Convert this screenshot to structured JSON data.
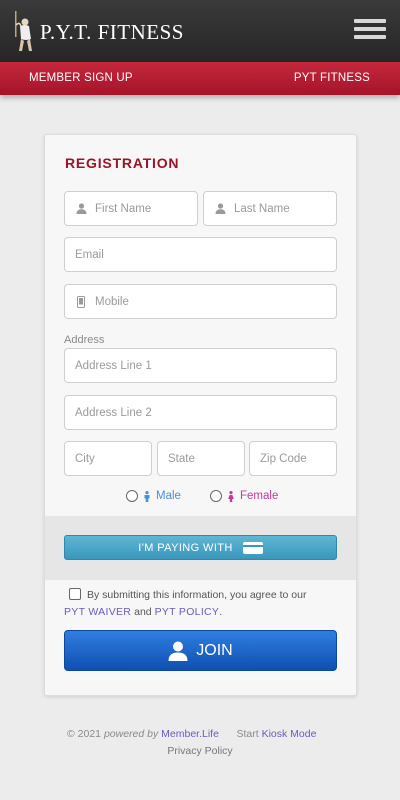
{
  "header": {
    "brand": "P.Y.T. FITNESS",
    "nav_left": "MEMBER SIGN UP",
    "nav_right": "PYT FITNESS"
  },
  "form": {
    "title": "REGISTRATION",
    "first_name_placeholder": "First Name",
    "last_name_placeholder": "Last Name",
    "email_placeholder": "Email",
    "mobile_placeholder": "Mobile",
    "address_label": "Address",
    "address1_placeholder": "Address Line 1",
    "address2_placeholder": "Address Line 2",
    "city_placeholder": "City",
    "state_placeholder": "State",
    "zip_placeholder": "Zip Code",
    "gender_male": "Male",
    "gender_female": "Female",
    "pay_button": "I'M PAYING WITH",
    "agree_text_1": "By submitting this information, you agree to our",
    "waiver_link": "PYT WAIVER",
    "agree_and": "and",
    "policy_link": "PYT POLICY",
    "agree_end": ".",
    "join_button": "JOIN"
  },
  "footer": {
    "copyright": "© 2021",
    "powered_by": "powered by",
    "powered_link": "Member.Life",
    "start": "Start",
    "kiosk_link": "Kiosk Mode",
    "privacy": "Privacy Policy"
  },
  "colors": {
    "accent_red": "#a5142a",
    "male_blue": "#4a90d9",
    "female_pink": "#c23a9a",
    "join_blue": "#1a5fc4",
    "link_purple": "#6b5bbd"
  }
}
